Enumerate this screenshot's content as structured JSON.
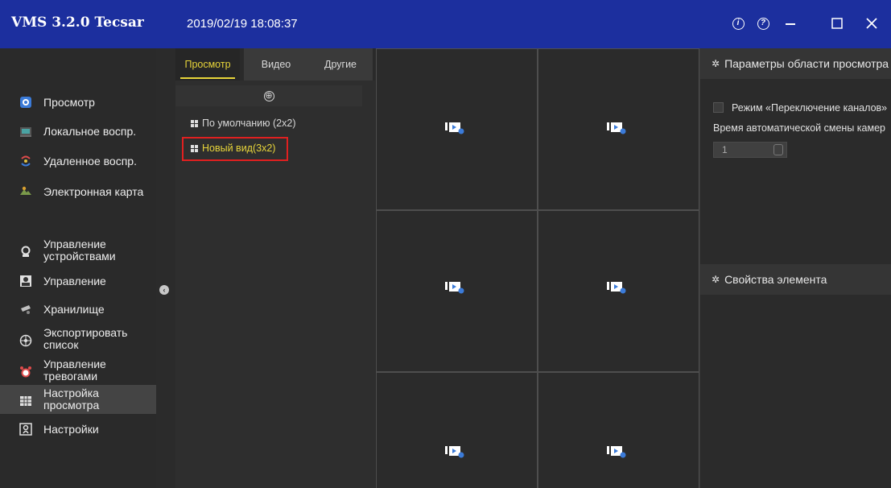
{
  "app": {
    "title": "VMS 3.2.0 Tecsar",
    "datetime": "2019/02/19 18:08:37"
  },
  "window_controls": {
    "info_icon": "info-icon",
    "help_icon": "help-icon",
    "min_icon": "minimize-icon",
    "max_icon": "maximize-icon",
    "close_icon": "close-icon"
  },
  "nav": {
    "items": [
      {
        "label": "Просмотр",
        "icon": "live-view-icon",
        "color": "#3b7bd9"
      },
      {
        "label": "Локальное воспр.",
        "icon": "local-playback-icon",
        "color": "#4aa3a3"
      },
      {
        "label": "Удаленное воспр.",
        "icon": "remote-playback-icon",
        "color": "#e04b4b"
      },
      {
        "label": "Электронная карта",
        "icon": "emap-icon",
        "color": "#7a9a4a"
      },
      {
        "label": "Управление устройствами",
        "icon": "device-management-icon",
        "color": "#e0e0e0"
      },
      {
        "label": "Управление",
        "icon": "user-management-icon",
        "color": "#e0e0e0"
      },
      {
        "label": "Хранилище",
        "icon": "storage-icon",
        "color": "#c0c0c0"
      },
      {
        "label": "Экспортировать список",
        "icon": "export-list-icon",
        "color": "#e0e0e0"
      },
      {
        "label": "Управление тревогами",
        "icon": "alarm-clock-icon",
        "color": "#e04b4b"
      },
      {
        "label": "Настройка просмотра",
        "icon": "view-settings-icon",
        "color": "#e0e0e0"
      },
      {
        "label": "Настройки",
        "icon": "settings-icon",
        "color": "#e0e0e0"
      }
    ]
  },
  "views_panel": {
    "tabs": [
      "Просмотр",
      "Видео",
      "Другие"
    ],
    "active_tab": "Просмотр",
    "add_symbol": "⊕",
    "items": [
      {
        "label": "По умолчанию (2x2)"
      },
      {
        "label": "Новый вид(3x2)",
        "selected": true
      }
    ]
  },
  "grid": {
    "rows": 3,
    "cols": 2
  },
  "right_panel": {
    "section1_title": "Параметры области просмотра",
    "switch_mode_label": "Режим «Переключение каналов»",
    "auto_switch_label": "Время автоматической смены камер",
    "auto_switch_value": "1",
    "section2_title": "Свойства элемента"
  },
  "colors": {
    "titlebar": "#1c2f9e",
    "accent_yellow": "#e8d53a",
    "highlight_red": "#e02020"
  }
}
